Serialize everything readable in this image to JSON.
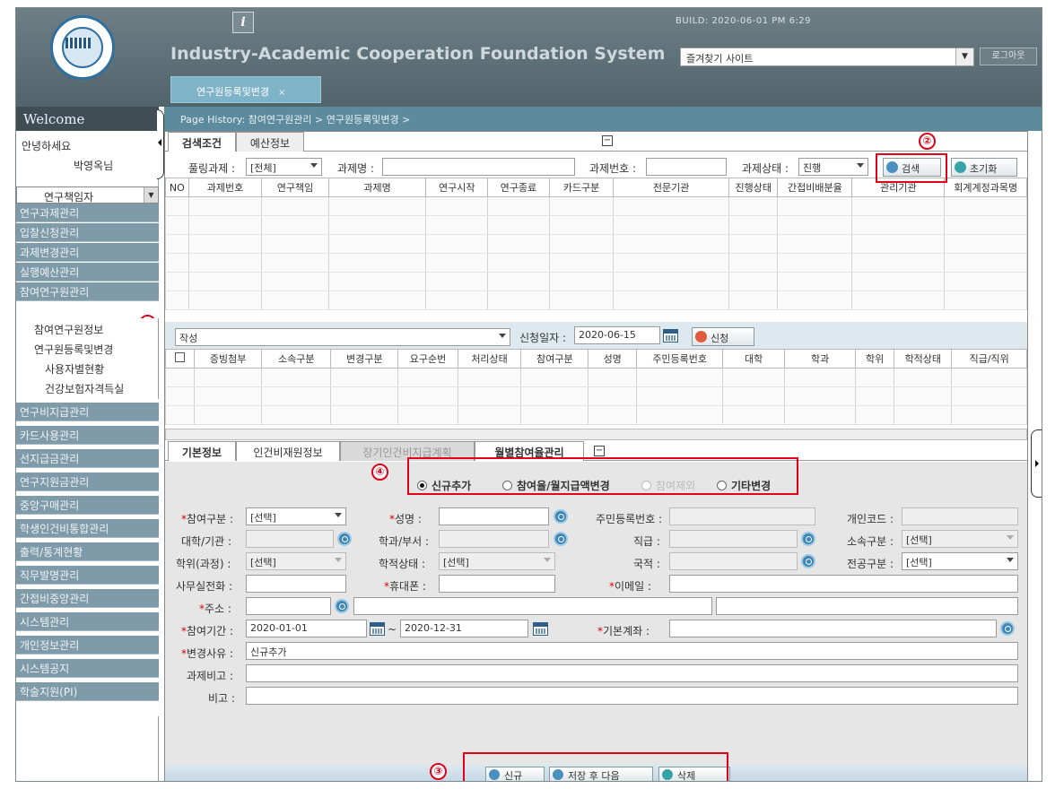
{
  "header": {
    "build": "BUILD: 2020-06-01 PM 6:29",
    "system_title": "Industry-Academic Cooperation Foundation System",
    "favorites": "즐겨찾기 사이트",
    "logout": "로그아웃",
    "info_icon": "info-icon",
    "main_tab": "연구원등록및변경",
    "main_tab_close": "×"
  },
  "sidebar": {
    "welcome": "Welcome",
    "greeting": "안녕하세요",
    "user": "박영옥님",
    "role": "연구책임자",
    "menus_top": [
      "연구과제관리",
      "입찰신청관리",
      "과제변경관리",
      "실행예산관리",
      "참여연구원관리"
    ],
    "submenus": [
      "참여연구원정보",
      "연구원등록및변경",
      "사용자별현황",
      "건강보험자격득실"
    ],
    "menus_bottom": [
      "연구비지급관리",
      "카드사용관리",
      "선지급금관리",
      "연구지원금관리",
      "중앙구매관리",
      "학생인건비통합관리",
      "출력/통계현황",
      "직무발명관리",
      "간접비중앙관리",
      "시스템관리",
      "개인정보관리",
      "시스템공지",
      "학술지원(PI)"
    ]
  },
  "history": "Page History:  참여연구원관리 > 연구원등록및변경 >",
  "search": {
    "tabs": [
      "검색조건",
      "예산정보"
    ],
    "lbl_pool": "풀링과제 :",
    "pool_value": "[전체]",
    "lbl_name": "과제명 :",
    "lbl_no": "과제번호 :",
    "lbl_status": "과제상태 :",
    "status_value": "진행",
    "btn_search": "검색",
    "btn_reset": "초기화",
    "columns": [
      "NO",
      "과제번호",
      "연구책임",
      "과제명",
      "연구시작",
      "연구종료",
      "카드구분",
      "전문기관",
      "진행상태",
      "간접비배분율",
      "관리기관",
      "회계계정과목명"
    ]
  },
  "request": {
    "type_value": "작성",
    "lbl_date": "신청일자 :",
    "date_value": "2020-06-15",
    "btn_apply": "신청",
    "columns": [
      "",
      "증빙첨부",
      "소속구분",
      "변경구분",
      "요구순번",
      "처리상태",
      "참여구분",
      "성명",
      "주민등록번호",
      "대학",
      "학과",
      "학위",
      "학적상태",
      "직급/직위"
    ]
  },
  "detail": {
    "tabs": [
      "기본정보",
      "인건비재원정보",
      "장기인건비지급계획",
      "월별참여율관리"
    ],
    "radios": [
      "신규추가",
      "참여율/월지급액변경",
      "참여제외",
      "기타변경"
    ],
    "lbl_join_type": "참여구분 :",
    "join_type": "[선택]",
    "lbl_name": "성명 :",
    "lbl_rrn": "주민등록번호 :",
    "lbl_personal": "개인코드 :",
    "lbl_univ": "대학/기관 :",
    "lbl_dept": "학과/부서 :",
    "lbl_grade": "직급 :",
    "lbl_affil": "소속구분 :",
    "affil": "[선택]",
    "lbl_degree": "학위(과정) :",
    "degree": "[선택]",
    "lbl_acad": "학적상태 :",
    "acad": "[선택]",
    "lbl_nation": "국적 :",
    "lbl_major": "전공구분 :",
    "major": "[선택]",
    "lbl_office": "사무실전화 :",
    "lbl_mobile": "휴대폰 :",
    "lbl_email": "이메일 :",
    "lbl_addr": "주소 :",
    "lbl_period": "참여기간 :",
    "period_from": "2020-01-01",
    "tilde": "~",
    "period_to": "2020-12-31",
    "lbl_account": "기본계좌 :",
    "lbl_reason": "변경사유 :",
    "reason": "신규추가",
    "lbl_note1": "과제비고 :",
    "lbl_note2": "비고 :"
  },
  "footer": {
    "btn_new": "신규",
    "btn_save_next": "저장 후 다음",
    "btn_delete": "삭제"
  },
  "annotations": [
    "①",
    "②",
    "③",
    "④"
  ],
  "colors": {
    "highlight": "#e0001b",
    "menu": "#7f9aa8",
    "header": "#5d6f76"
  }
}
